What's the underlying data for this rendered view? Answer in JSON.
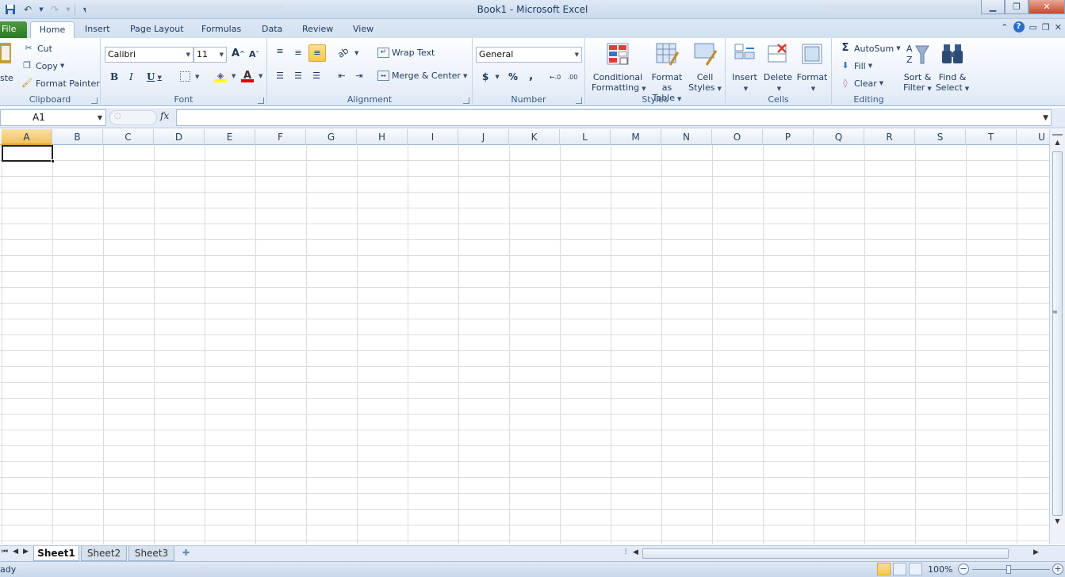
{
  "window": {
    "title": "Book1  -  Microsoft Excel"
  },
  "tabs": [
    {
      "label": "File"
    },
    {
      "label": "Home"
    },
    {
      "label": "Insert"
    },
    {
      "label": "Page Layout"
    },
    {
      "label": "Formulas"
    },
    {
      "label": "Data"
    },
    {
      "label": "Review"
    },
    {
      "label": "View"
    }
  ],
  "clipboard": {
    "paste_label": "ste",
    "cut_label": "Cut",
    "copy_label": "Copy",
    "format_painter_label": "Format Painter",
    "group_label": "Clipboard"
  },
  "font": {
    "font_name": "Calibri",
    "font_size": "11",
    "bold": "B",
    "italic": "I",
    "underline": "U",
    "grow": "A",
    "shrink": "A",
    "font_color": "A",
    "group_label": "Font"
  },
  "alignment": {
    "wrap_text_label": "Wrap Text",
    "merge_center_label": "Merge & Center",
    "group_label": "Alignment"
  },
  "number": {
    "format_value": "General",
    "currency": "$",
    "percent": "%",
    "comma": ",",
    "group_label": "Number"
  },
  "styles": {
    "conditional_formatting_line1": "Conditional",
    "conditional_formatting_line2": "Formatting",
    "format_as_table_line1": "Format",
    "format_as_table_line2": "as Table",
    "cell_styles_line1": "Cell",
    "cell_styles_line2": "Styles",
    "group_label": "Styles"
  },
  "cells": {
    "insert_label": "Insert",
    "delete_label": "Delete",
    "format_label": "Format",
    "group_label": "Cells"
  },
  "editing": {
    "autosum_label": "AutoSum",
    "fill_label": "Fill",
    "clear_label": "Clear",
    "sort_filter_line1": "Sort &",
    "sort_filter_line2": "Filter",
    "find_select_line1": "Find &",
    "find_select_line2": "Select",
    "group_label": "Editing"
  },
  "formula_bar": {
    "name_box_value": "A1",
    "fx_label": "fx",
    "formula_value": ""
  },
  "columns": [
    "A",
    "B",
    "C",
    "D",
    "E",
    "F",
    "G",
    "H",
    "I",
    "J",
    "K",
    "L",
    "M",
    "N",
    "O",
    "P",
    "Q",
    "R",
    "S",
    "T",
    "U"
  ],
  "active_column": "A",
  "sheets": [
    {
      "label": "Sheet1"
    },
    {
      "label": "Sheet2"
    },
    {
      "label": "Sheet3"
    }
  ],
  "active_sheet": "Sheet1",
  "status": {
    "text": "ady",
    "zoom_label": "100%"
  },
  "colors": {
    "file_tab": "#2c7a25",
    "ribbon_bg": "#e9f0f9",
    "active_header": "#f1c15f",
    "grid_line": "#dadcdd"
  }
}
